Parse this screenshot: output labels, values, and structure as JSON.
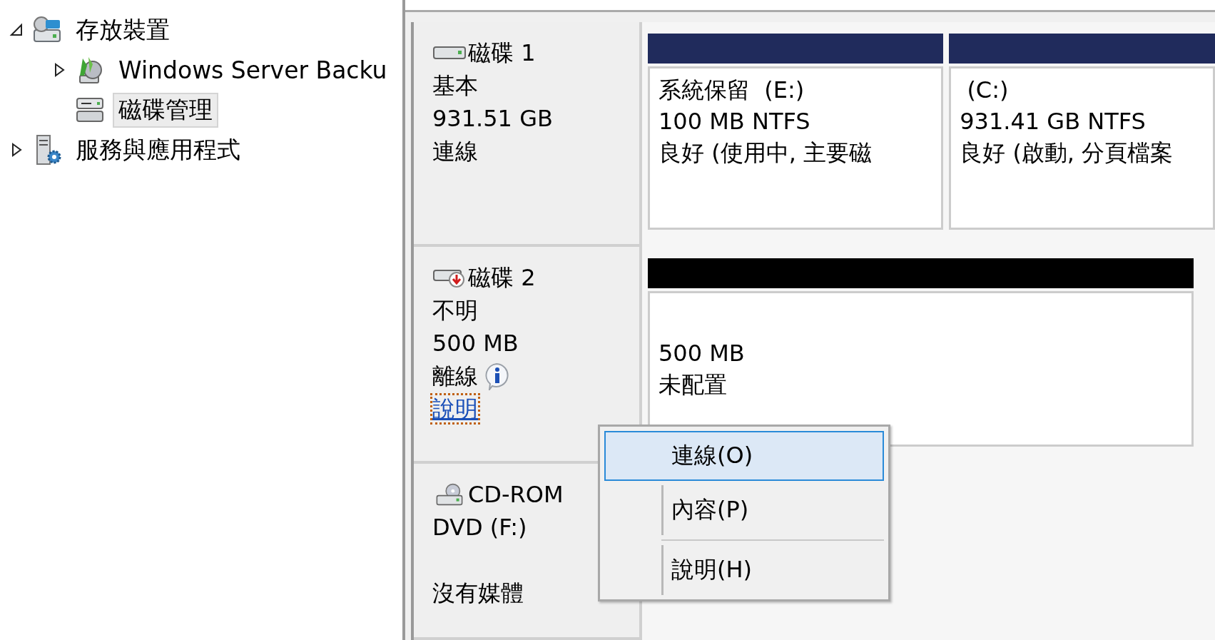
{
  "tree": [
    {
      "label": "存放裝置",
      "kind": "storage",
      "expanded": true,
      "selected": false,
      "children": [
        {
          "label": "Windows Server Backu",
          "kind": "backup",
          "expanded": false,
          "selected": false
        },
        {
          "label": "磁碟管理",
          "kind": "disk",
          "selected": true
        }
      ]
    },
    {
      "label": "服務與應用程式",
      "kind": "services",
      "expanded": false,
      "selected": false
    }
  ],
  "disks": [
    {
      "kind": "basic",
      "name": "磁碟 1",
      "lines": [
        "基本",
        "931.51 GB",
        "連線"
      ],
      "partitions": [
        {
          "color": "#202b5c",
          "lines": [
            "系統保留  (E:)",
            "100 MB NTFS",
            "良好 (使用中, 主要磁"
          ]
        },
        {
          "color": "#202b5c",
          "lines": [
            " (C:)",
            "931.41 GB NTFS",
            "良好 (啟動, 分頁檔案"
          ]
        }
      ]
    },
    {
      "kind": "offline",
      "name": "磁碟 2",
      "lines": [
        "不明",
        "500 MB"
      ],
      "status": "離線",
      "link": "說明",
      "partitions": [
        {
          "color": "#000000",
          "lines": [
            "500 MB",
            "未配置"
          ]
        }
      ]
    },
    {
      "kind": "cdrom",
      "name": "CD-ROM",
      "lines": [
        "DVD (F:)"
      ],
      "status": "沒有媒體"
    }
  ],
  "menu": [
    {
      "label": "連線(O)",
      "selected": true
    },
    {
      "label": "內容(P)",
      "selected": false
    },
    {
      "label": "說明(H)",
      "selected": false
    }
  ]
}
